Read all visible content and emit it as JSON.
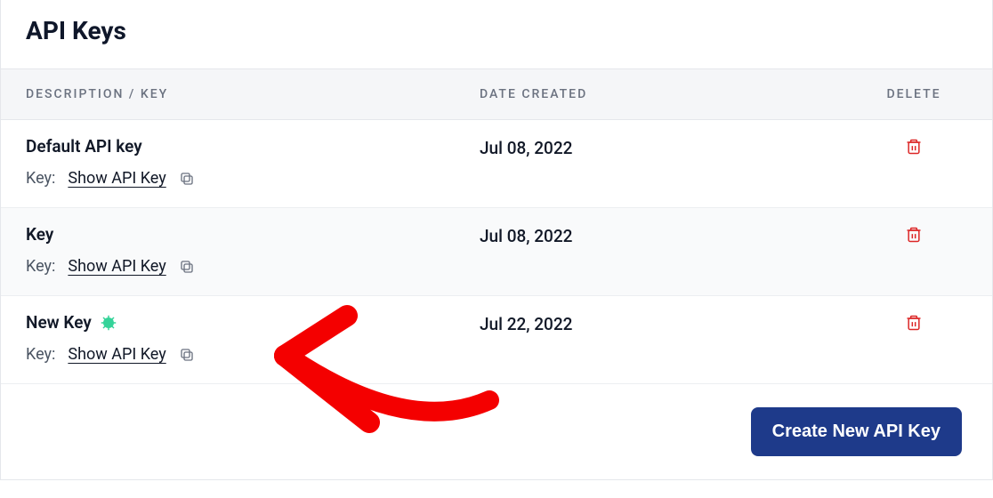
{
  "page": {
    "title": "API Keys"
  },
  "columns": {
    "desc": "DESCRIPTION / KEY",
    "date": "DATE CREATED",
    "del": "DELETE"
  },
  "labels": {
    "key_prefix": "Key:",
    "show": "Show API Key"
  },
  "rows": [
    {
      "description": "Default API key",
      "date": "Jul 08, 2022",
      "is_new": false
    },
    {
      "description": "Key",
      "date": "Jul 08, 2022",
      "is_new": false
    },
    {
      "description": "New Key",
      "date": "Jul 22, 2022",
      "is_new": true
    }
  ],
  "footer": {
    "create_label": "Create New API Key"
  },
  "colors": {
    "accent": "#1e3a8a",
    "danger": "#dc2626",
    "new_badge": "#34d399"
  }
}
